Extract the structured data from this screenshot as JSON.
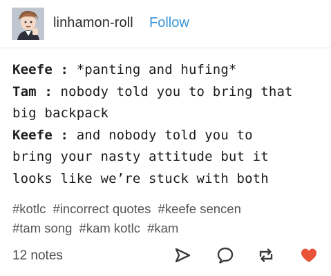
{
  "header": {
    "username": "linhamon-roll",
    "follow_label": "Follow"
  },
  "post": {
    "lines": [
      {
        "speaker": "Keefe :",
        "text": " *panting and hufing*"
      },
      {
        "speaker": "Tam :",
        "text": " nobody told you to bring that"
      },
      {
        "speaker": "",
        "text": "big backpack"
      },
      {
        "speaker": "Keefe :",
        "text": " and nobody told you to"
      },
      {
        "speaker": "",
        "text": "bring your nasty attitude but it"
      },
      {
        "speaker": "",
        "text": "looks like we’re stuck with both"
      }
    ]
  },
  "tags": [
    "#kotlc",
    "#incorrect quotes",
    "#keefe sencen",
    "#tam song",
    "#kam kotlc",
    "#kam"
  ],
  "footer": {
    "notes": "12 notes",
    "icons": [
      "share-icon",
      "reply-icon",
      "reblog-icon",
      "like-icon"
    ],
    "like_color": "#e8533a"
  },
  "colors": {
    "follow": "#3a95d8",
    "text": "#1c1c1c",
    "tags": "#555555"
  }
}
